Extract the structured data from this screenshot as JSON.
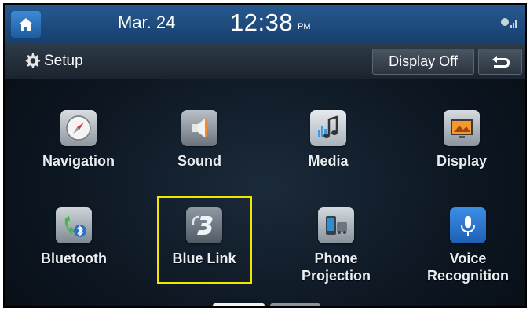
{
  "status": {
    "date": "Mar. 24",
    "time": "12:38",
    "ampm": "PM"
  },
  "header": {
    "title": "Setup",
    "display_off_label": "Display Off"
  },
  "tiles": [
    {
      "label": "Navigation",
      "icon": "navigation-compass-icon"
    },
    {
      "label": "Sound",
      "icon": "speaker-icon"
    },
    {
      "label": "Media",
      "icon": "media-music-icon"
    },
    {
      "label": "Display",
      "icon": "display-picture-icon"
    },
    {
      "label": "Bluetooth",
      "icon": "bluetooth-phone-icon"
    },
    {
      "label": "Blue Link",
      "icon": "blue-link-icon"
    },
    {
      "label": "Phone Projection",
      "label_lines": [
        "Phone",
        "Projection"
      ],
      "icon": "phone-projection-icon"
    },
    {
      "label": "Voice Recognition",
      "label_lines": [
        "Voice",
        "Recognition"
      ],
      "icon": "microphone-icon"
    }
  ],
  "pager": {
    "pages": 2,
    "current": 1
  },
  "colors": {
    "status_bar": "#1f4f84",
    "highlight_box": "#f2e600",
    "background": "#0d1722"
  }
}
